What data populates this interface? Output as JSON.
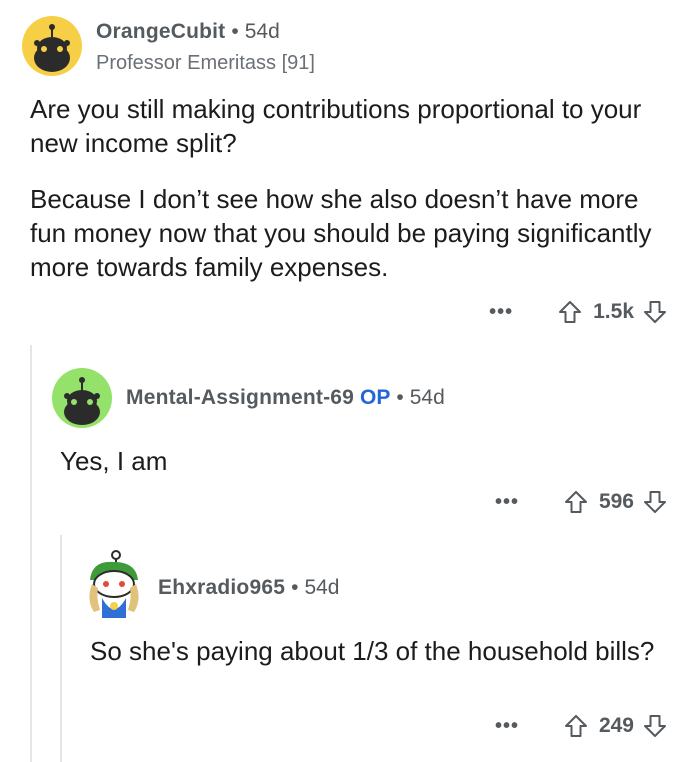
{
  "comments": [
    {
      "author": "OrangeCubit",
      "separator": "•",
      "age": "54d",
      "flair": "Professor Emeritass [91]",
      "avatar_color": "#f7cf46",
      "paragraphs": [
        "Are you still making contributions proportional to your new income split?",
        "Because I don’t see how she also doesn’t have more fun money now that you should be paying significantly more towards family expenses."
      ],
      "more": "•••",
      "score": "1.5k"
    },
    {
      "author": "Mental-Assignment-69",
      "op_badge": "OP",
      "separator": "•",
      "age": "54d",
      "avatar_color": "#94e26a",
      "paragraphs": [
        "Yes, I am"
      ],
      "more": "•••",
      "score": "596"
    },
    {
      "author": "Ehxradio965",
      "separator": "•",
      "age": "54d",
      "avatar_color": "#ffffff",
      "paragraphs": [
        "So she's paying about 1/3 of the household bills?"
      ],
      "more": "•••",
      "score": "249"
    }
  ],
  "colors": {
    "meta_text": "#555a5e",
    "op_badge": "#2466d6",
    "thread_line": "#e4e5e7"
  },
  "icons": {
    "upvote": "arrow-up-outline-icon",
    "downvote": "arrow-down-outline-icon",
    "more": "ellipsis-icon"
  }
}
